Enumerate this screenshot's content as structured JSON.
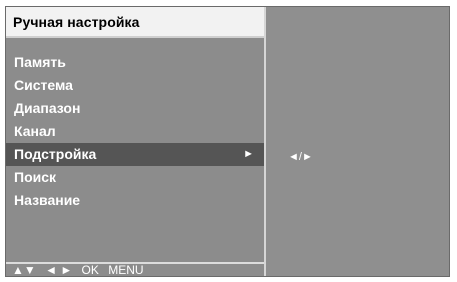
{
  "menu": {
    "title": "Ручная настройка",
    "items": [
      {
        "label": "Память"
      },
      {
        "label": "Система"
      },
      {
        "label": "Диапазон"
      },
      {
        "label": "Канал"
      },
      {
        "label": "Подстройка",
        "arrow": "►",
        "selected": true
      },
      {
        "label": "Поиск"
      },
      {
        "label": "Название"
      }
    ]
  },
  "hints": {
    "updown": "▲▼",
    "leftright": "◄ ►",
    "ok": "OK",
    "menu": "MENU"
  },
  "right_panel": {
    "indicator": "◄/►"
  },
  "colors": {
    "panel_background": "#8f8f8f",
    "title_background": "#f2f2f2",
    "selected_row": "#555555",
    "text": "#ffffff"
  }
}
